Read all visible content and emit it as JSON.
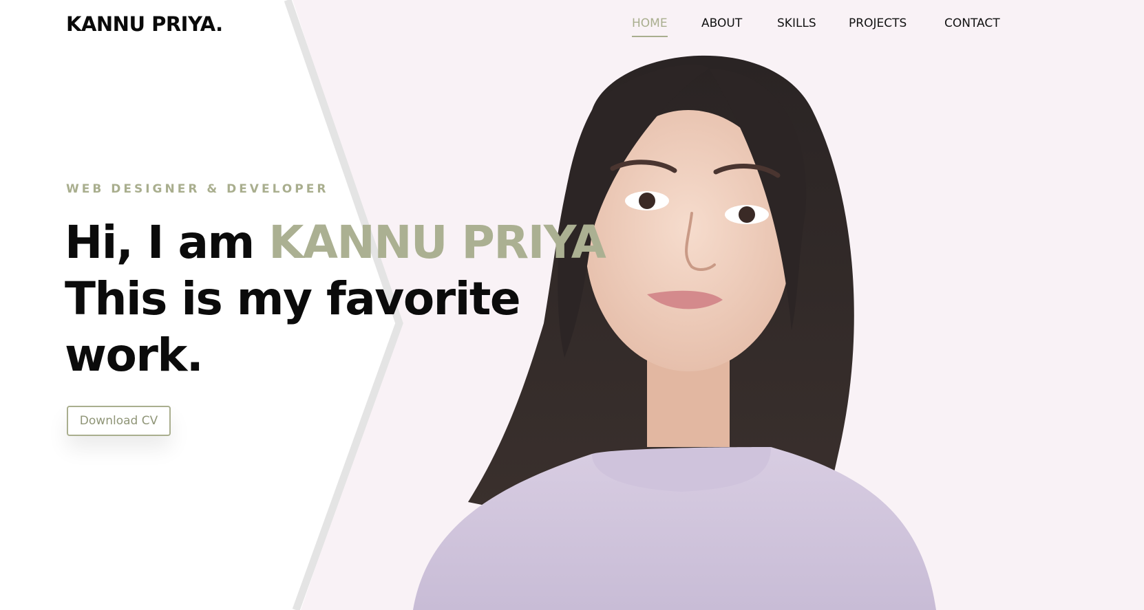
{
  "brand": {
    "logo_text": "KANNU PRIYA."
  },
  "nav": {
    "items": [
      {
        "label": "HOME",
        "active": true
      },
      {
        "label": "ABOUT",
        "active": false
      },
      {
        "label": "SKILLS",
        "active": false
      },
      {
        "label": "PROJECTS",
        "active": false
      },
      {
        "label": "CONTACT",
        "active": false
      }
    ]
  },
  "hero": {
    "eyebrow": "WEB DESIGNER & DEVELOPER",
    "greeting": "Hi, I am ",
    "name": "KANNU PRIYA",
    "line2": "This is my favorite",
    "line3": "work.",
    "cta_label": "Download CV"
  },
  "colors": {
    "accent": "#a9ae8e",
    "text": "#0b0b0b",
    "panel_bg": "#f9f2f6",
    "divider": "#e3e3e3"
  }
}
